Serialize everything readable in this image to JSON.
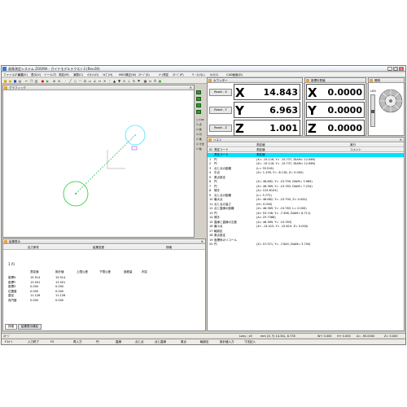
{
  "window": {
    "title": "画像測定システム ZOOMA - ガイドモデルテクスト3 (Rev.00)"
  },
  "menu": [
    "ファイル(F)",
    "編集(E)",
    "表示(V)",
    "ツール(T)",
    "測定(M)",
    "演算(C)",
    "ｵﾌｾｯﾄ(O)",
    "ﾍﾙﾌﾟ(H)",
    "MSG補正(W)",
    "ｽﾃｰｼﾞ(S)",
    "ｵｰﾄ測定",
    "ｽﾃｰｼﾞ(P)",
    "Y・ﾛｯｸ(L)",
    "ｶﾒﾗ(C)",
    "CAD画面(D)"
  ],
  "graphic": {
    "title": "グラフィック"
  },
  "side_labels": [
    "□ 100",
    "☑ 点",
    "☑ 線",
    "☑ 円",
    "☑ 角",
    "☑ 寸法",
    "☑ 他"
  ],
  "counter": {
    "title": "カウンター",
    "reset_label": "Reset",
    "axes": [
      {
        "axis": "X",
        "value": "14.843",
        "reset": "Reset - X"
      },
      {
        "axis": "Y",
        "value": "6.963",
        "reset": "Reset - Y"
      },
      {
        "axis": "Z",
        "value": "1.001",
        "reset": "Reset - Z"
      }
    ]
  },
  "coord_counter": {
    "title": "座標計算値",
    "axes": [
      {
        "axis": "X",
        "value": "0.0000"
      },
      {
        "axis": "Y",
        "value": "0.0000"
      },
      {
        "axis": "Z",
        "value": "0.0000"
      }
    ]
  },
  "light": {
    "title": "照明",
    "label": "LED"
  },
  "list": {
    "title": "リスト",
    "headers": [
      "ID",
      "測定コード",
      "測定値",
      "",
      "コメント"
    ],
    "subheaders": [
      "測定値",
      "実行"
    ],
    "rows": [
      {
        "id": "",
        "name": "測定コード",
        "text": "測定値"
      },
      {
        "id": "1",
        "name": "円",
        "text": "(X= -15.116, Y= -15.737, DIAM= 12.669)"
      },
      {
        "id": "2",
        "name": "円",
        "text": "(X= -15.116, Y= -15.737, DIAM= 12.669)"
      },
      {
        "id": "3",
        "name": "点と点の距離",
        "text": "(L= 35.516)"
      },
      {
        "id": "4",
        "name": "中点",
        "text": "(X= 1.199, Y= -8.118, Z= 0.000)"
      },
      {
        "id": "5",
        "name": "原点設定",
        "text": ""
      },
      {
        "id": "6",
        "name": "円",
        "text": "(X= 46.682, Y= -15.790, DIAM= 3.965)"
      },
      {
        "id": "7",
        "name": "円",
        "text": "(X= 46.389, Y= -15.783, DIAM= 7.234)"
      },
      {
        "id": "8",
        "name": "傾き",
        "text": "(A= 125.8143)"
      },
      {
        "id": "9",
        "name": "点と点の距離",
        "text": "(L= 3.772)"
      },
      {
        "id": "10",
        "name": "最大点",
        "text": "(X= 46.682, Y= -15.790, Z= 0.000)"
      },
      {
        "id": "11",
        "name": "点と点の高さ",
        "text": "(H= 0.000)"
      },
      {
        "id": "12",
        "name": "点と直線の距離",
        "text": "(X= 46.389, Y= -15.783, L= 0.000)"
      },
      {
        "id": "13",
        "name": "円",
        "text": "(X= 53.746, Y= -7.498, DIAM= 6.711)"
      },
      {
        "id": "14",
        "name": "傾き",
        "text": "(A= 25.7366)"
      },
      {
        "id": "15",
        "name": "直線と直線の交差",
        "text": "(X= 46.389, Y= -15.783)"
      },
      {
        "id": "16",
        "name": "最小点",
        "text": "(X= -14.015, Y= -15.619, Z= 0.000)"
      },
      {
        "id": "17",
        "name": "軸設定",
        "text": ""
      },
      {
        "id": "18",
        "name": "原点設定",
        "text": ""
      },
      {
        "id": "19",
        "name": "座標系のリコール",
        "text": ""
      },
      {
        "id": "20",
        "name": "円",
        "text": "(X= 57.971, Y= -7.849, DIAM= 3.700)"
      }
    ]
  },
  "results": {
    "title": "結果表示",
    "headers": [
      "出力条件",
      "結果変更",
      "詳細"
    ],
    "item": "1  円",
    "col_headers": [
      "測定値",
      "設計値",
      "上限公差",
      "下限公差",
      "誤差量",
      "判定"
    ],
    "rows": [
      {
        "label": "座標X",
        "measured": "15.514",
        "design": "15.514"
      },
      {
        "label": "座標Y",
        "measured": "13.501",
        "design": "13.501"
      },
      {
        "label": "座標Z",
        "measured": "0.000",
        "design": "0.000"
      },
      {
        "label": "位置度",
        "measured": "0.000",
        "design": "0.000"
      },
      {
        "label": "直径",
        "measured": "11.126",
        "design": "11.126"
      },
      {
        "label": "真円度",
        "measured": "0.000",
        "design": "0.000"
      }
    ],
    "tabs": [
      "詳細",
      "結果表示補足"
    ]
  },
  "status": {
    "left": "ｽﾃｰｼﾞ",
    "lens": "Lens : x5",
    "mm": "mm",
    "coords": "(X, Y) 14.34L,  6.735",
    "w": "W+  0.000",
    "h": "H+  0.000",
    "a": "A= -90.0000",
    "z": "Z= 0.000"
  },
  "fkeys": [
    "F1ｵｰﾄ",
    "入力終了",
    "F5",
    "再入力",
    "円",
    "直線",
    "点と点",
    "点と直線",
    "原点",
    "軸設定",
    "設計値入力",
    "寸法記入"
  ],
  "colors": {
    "accent": "#00e0ff",
    "cyan_circle": "#45e6ff",
    "green_circle": "#22cc22",
    "dashed": "#00c850"
  }
}
